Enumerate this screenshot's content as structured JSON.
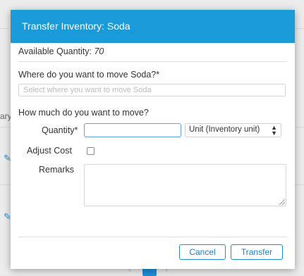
{
  "background": {
    "partial_text": "ary",
    "pager_current": "1"
  },
  "modal": {
    "title": "Transfer Inventory: Soda",
    "available_label": "Available Quantity:",
    "available_value": "70",
    "where_question": "Where do you want to move Soda?*",
    "where_placeholder": "Select where you want to move Soda",
    "how_much_question": "How much do you want to move?",
    "quantity_label": "Quantity*",
    "quantity_value": "",
    "unit_selected": "Unit (Inventory unit)",
    "adjust_cost_label": "Adjust Cost",
    "adjust_cost_checked": false,
    "remarks_label": "Remarks",
    "remarks_value": "",
    "cancel_label": "Cancel",
    "transfer_label": "Transfer"
  },
  "colors": {
    "header": "#1a9ad9",
    "accent": "#1a8fd8"
  }
}
